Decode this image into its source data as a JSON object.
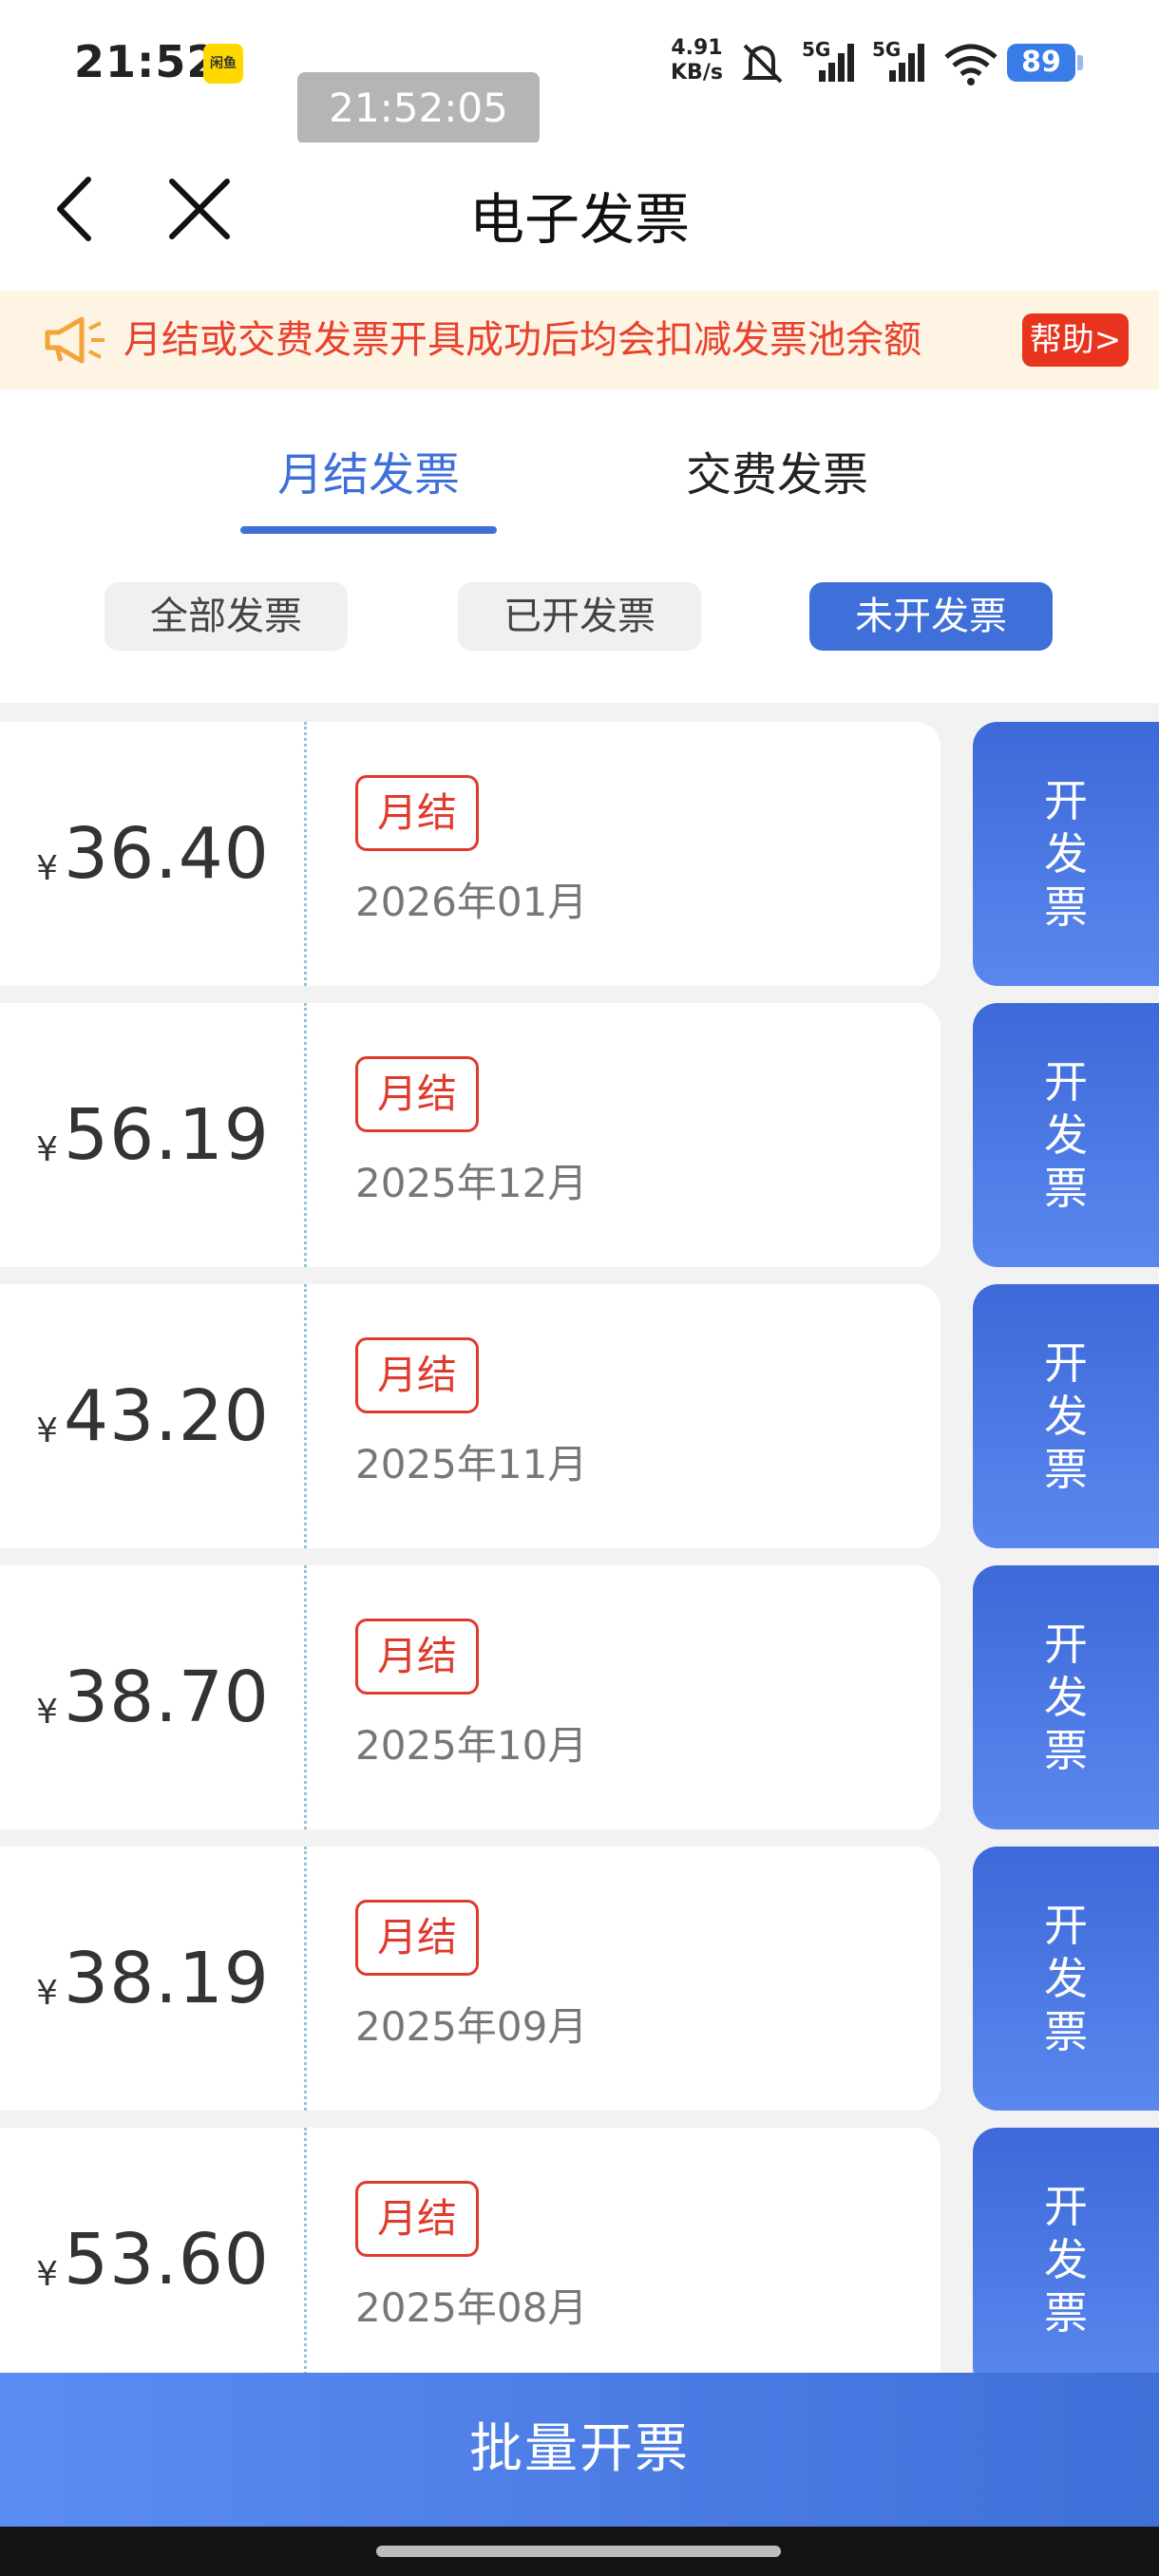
{
  "status_bar": {
    "time": "21:52",
    "app_icon_label": "闲鱼",
    "toast_time": "21:52:05",
    "net_speed_value": "4.91",
    "net_speed_unit": "KB/s",
    "signal_1_label": "5G",
    "signal_2_label": "5G",
    "battery": "89",
    "icons": [
      "mute-icon",
      "signal-icon",
      "signal-icon",
      "wifi-icon",
      "battery-icon"
    ]
  },
  "nav": {
    "title": "电子发票",
    "back_icon": "back-arrow-icon",
    "close_icon": "close-icon"
  },
  "notice": {
    "text": "月结或交费发票开具成功后均会扣减发票池余额",
    "help_label": "帮助>",
    "icon": "megaphone-icon",
    "color": "#e8412d"
  },
  "tabs": {
    "items": [
      {
        "label": "月结发票",
        "active": true
      },
      {
        "label": "交费发票",
        "active": false
      }
    ],
    "accent_color": "#3f6fd8"
  },
  "filters": {
    "items": [
      {
        "label": "全部发票",
        "active": false
      },
      {
        "label": "已开发票",
        "active": false
      },
      {
        "label": "未开发票",
        "active": true
      }
    ]
  },
  "invoices": [
    {
      "currency": "¥",
      "amount": "36.40",
      "tag": "月结",
      "period": "2026年01月",
      "action": [
        "开",
        "发",
        "票"
      ]
    },
    {
      "currency": "¥",
      "amount": "56.19",
      "tag": "月结",
      "period": "2025年12月",
      "action": [
        "开",
        "发",
        "票"
      ]
    },
    {
      "currency": "¥",
      "amount": "43.20",
      "tag": "月结",
      "period": "2025年11月",
      "action": [
        "开",
        "发",
        "票"
      ]
    },
    {
      "currency": "¥",
      "amount": "38.70",
      "tag": "月结",
      "period": "2025年10月",
      "action": [
        "开",
        "发",
        "票"
      ]
    },
    {
      "currency": "¥",
      "amount": "38.19",
      "tag": "月结",
      "period": "2025年09月",
      "action": [
        "开",
        "发",
        "票"
      ]
    },
    {
      "currency": "¥",
      "amount": "53.60",
      "tag": "月结",
      "period": "2025年08月",
      "action": [
        "开",
        "发",
        "票"
      ]
    }
  ],
  "batch_button": {
    "label": "批量开票"
  }
}
